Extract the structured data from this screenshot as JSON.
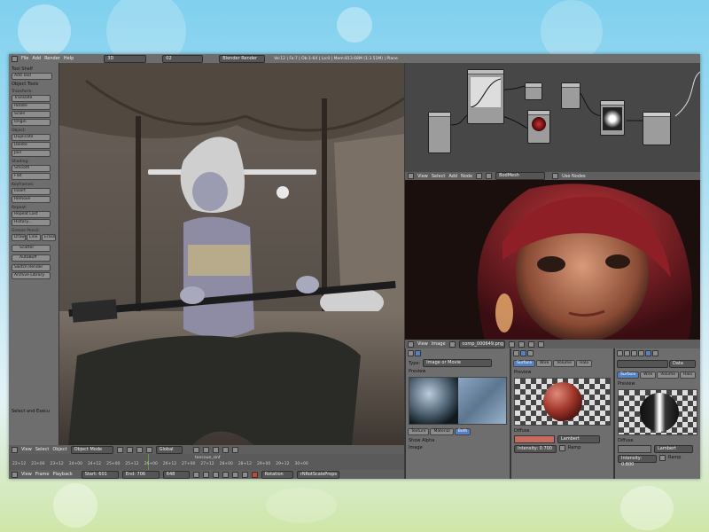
{
  "topbar": {
    "menus": [
      "File",
      "Add",
      "Render",
      "Help"
    ],
    "screen_layout": "3D",
    "scene": "02",
    "render_engine": "Blender Render",
    "stats": "Ve:12 | Fa:7 | Ob:1-64 | La:0 | Mem:813.68M (1:3.51M) | Plane"
  },
  "toolshelf": {
    "title": "Tool Shelf",
    "add_tool": "Add Tool",
    "object_tools": "Object Tools",
    "groups": [
      {
        "label": "Transform:",
        "buttons": [
          "Translate",
          "Rotate",
          "Scale",
          "Origin"
        ]
      },
      {
        "label": "Object:",
        "buttons": [
          "Duplicate",
          "Delete",
          "Join"
        ]
      },
      {
        "label": "Shading:",
        "buttons": [
          "Smooth",
          "Flat"
        ]
      },
      {
        "label": "Keyframes:",
        "buttons": [
          "Insert",
          "Remove"
        ]
      },
      {
        "label": "Repeat:",
        "buttons": [
          "Repeat Last",
          "History..."
        ]
      },
      {
        "label": "Grease Pencil:",
        "buttons": [
          "Draw",
          "Line",
          "Erase"
        ]
      }
    ],
    "extra_buttons": [
      "Scatter",
      "AutoBuff",
      "Switch Render",
      "Archive Library"
    ],
    "select_and_exec": "Select and Execu"
  },
  "viewport_header": {
    "menus": [
      "View",
      "Select",
      "Object"
    ],
    "mode": "Object Mode",
    "orientation": "Global"
  },
  "timeline": {
    "frame_markers": [
      "22+12",
      "23+00",
      "23+12",
      "24+00",
      "24+12",
      "25+00",
      "25+12",
      "26+00",
      "26+12",
      "27+00",
      "27+12",
      "28+00",
      "28+12",
      "29+00",
      "29+12",
      "30+00"
    ],
    "marker": "tencoue_sinf",
    "menus": [
      "View",
      "Frame",
      "Playback"
    ],
    "start": "Start: 601",
    "end": "End: 706",
    "current": "648",
    "keying_set": "Rotation",
    "keying_tail": "rNRotScaleProps"
  },
  "node_header": {
    "menus": [
      "View",
      "Select",
      "Add",
      "Node"
    ],
    "material": "BodMesh",
    "use_nodes": "Use Nodes"
  },
  "image_header": {
    "menus": [
      "View",
      "Image"
    ],
    "image_name": "comp_000649.png"
  },
  "properties": [
    {
      "type_label": "Type:",
      "type_value": "Image or Movie",
      "preview_label": "Preview",
      "tabs": [
        "Texture",
        "Material",
        "Both"
      ],
      "selected_tab": 2,
      "rows": [
        "Show Alpha",
        "Image"
      ]
    },
    {
      "tabs": [
        "Surface",
        "Wire",
        "Volume",
        "Halo"
      ],
      "selected_tab": 0,
      "preview_label": "Preview",
      "section": "Diffuse",
      "shader": "Lambert",
      "intensity": "Intensity: 0.700",
      "ramp": "Ramp"
    },
    {
      "tabs": [
        "Surface",
        "Wire",
        "Volume",
        "Halo"
      ],
      "selected_tab": 0,
      "data_label": "Data",
      "preview_label": "Preview",
      "section": "Diffuse",
      "shader": "Lambert",
      "intensity": "Intensity: 0.800",
      "ramp": "Ramp"
    }
  ],
  "colors": {
    "accent": "#5680c2",
    "panel": "#6e6e6e",
    "header": "#6d6d6d"
  }
}
